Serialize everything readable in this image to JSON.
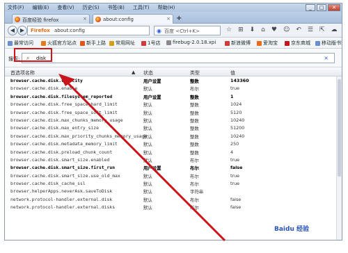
{
  "menu": [
    "文件(F)",
    "编辑(E)",
    "查看(V)",
    "历史(S)",
    "书签(B)",
    "工具(T)",
    "帮助(H)"
  ],
  "window_controls": {
    "minimize": "_",
    "maximize": "□",
    "close": "✕"
  },
  "tabs": [
    {
      "label": "百度经验 firefox",
      "active": false
    },
    {
      "label": "about:config",
      "active": true
    }
  ],
  "newtab_label": "+",
  "nav": {
    "url_brand": "Firefox",
    "url": "about:config",
    "search_placeholder": "百度 <Ctrl+K>",
    "icons": [
      "☆",
      "⊞",
      "⬇",
      "⌂",
      "♥",
      "☺",
      "↶",
      "☰",
      "⇱",
      "☁",
      "◈"
    ]
  },
  "bookmarks": [
    {
      "label": "最常访问",
      "color": "#6a8fd0"
    },
    {
      "label": "火狐官方站点",
      "color": "#e67a1c"
    },
    {
      "label": "新手上路",
      "color": "#e0561b"
    },
    {
      "label": "常用网址",
      "color": "#d4a017"
    },
    {
      "label": "1号店",
      "color": "#d23b3b"
    },
    {
      "label": "firebug-2.0.18.xpi",
      "color": "#8a8a8a"
    },
    {
      "label": "新浪微博",
      "color": "#d23b3b"
    },
    {
      "label": "爱淘宝",
      "color": "#ee6b1c"
    },
    {
      "label": "京东商城",
      "color": "#c4161c"
    },
    {
      "label": "移动版书签",
      "color": "#6a8fd0"
    }
  ],
  "filter": {
    "label": "搜索:",
    "value": "disk",
    "clear": "×"
  },
  "columns": [
    "首选项名称",
    "状态",
    "类型",
    "值"
  ],
  "rows": [
    {
      "name": "browser.cache.disk.capacity",
      "status": "用户设置",
      "type": "整数",
      "value": "143360",
      "bold": true
    },
    {
      "name": "browser.cache.disk.enable",
      "status": "默认",
      "type": "布尔",
      "value": "true",
      "bold": false
    },
    {
      "name": "browser.cache.disk.filesystem_reported",
      "status": "用户设置",
      "type": "整数",
      "value": "1",
      "bold": true
    },
    {
      "name": "browser.cache.disk.free_space_hard_limit",
      "status": "默认",
      "type": "整数",
      "value": "1024",
      "bold": false
    },
    {
      "name": "browser.cache.disk.free_space_soft_limit",
      "status": "默认",
      "type": "整数",
      "value": "5120",
      "bold": false
    },
    {
      "name": "browser.cache.disk.max_chunks_memory_usage",
      "status": "默认",
      "type": "整数",
      "value": "10240",
      "bold": false
    },
    {
      "name": "browser.cache.disk.max_entry_size",
      "status": "默认",
      "type": "整数",
      "value": "51200",
      "bold": false
    },
    {
      "name": "browser.cache.disk.max_priority_chunks_memory_usage",
      "status": "默认",
      "type": "整数",
      "value": "10240",
      "bold": false
    },
    {
      "name": "browser.cache.disk.metadata_memory_limit",
      "status": "默认",
      "type": "整数",
      "value": "250",
      "bold": false
    },
    {
      "name": "browser.cache.disk.preload_chunk_count",
      "status": "默认",
      "type": "整数",
      "value": "4",
      "bold": false
    },
    {
      "name": "browser.cache.disk.smart_size.enabled",
      "status": "默认",
      "type": "布尔",
      "value": "true",
      "bold": false
    },
    {
      "name": "browser.cache.disk.smart_size.first_run",
      "status": "用户设置",
      "type": "布尔",
      "value": "false",
      "bold": true
    },
    {
      "name": "browser.cache.disk.smart_size.use_old_max",
      "status": "默认",
      "type": "布尔",
      "value": "true",
      "bold": false
    },
    {
      "name": "browser.cache.disk_cache_ssl",
      "status": "默认",
      "type": "布尔",
      "value": "true",
      "bold": false
    },
    {
      "name": "browser.helperApps.neverAsk.saveToDisk",
      "status": "默认",
      "type": "字符串",
      "value": "",
      "bold": false
    },
    {
      "name": "network.protocol-handler.external.disk",
      "status": "默认",
      "type": "布尔",
      "value": "false",
      "bold": false
    },
    {
      "name": "network.protocol-handler.external.disks",
      "status": "默认",
      "type": "布尔",
      "value": "false",
      "bold": false
    }
  ],
  "colors": {
    "highlight": "#d0151a",
    "arrow": "#c8151c"
  },
  "watermark": "Baidu 经验"
}
